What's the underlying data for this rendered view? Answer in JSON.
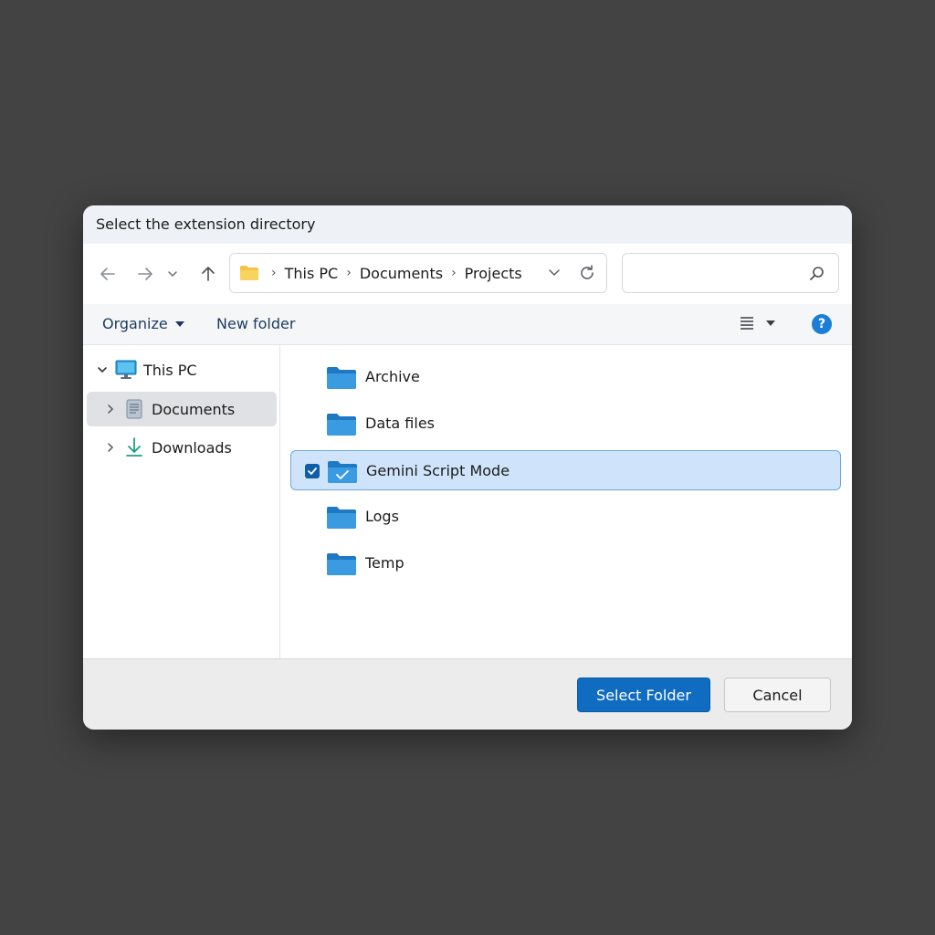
{
  "dialog": {
    "title": "Select the extension directory"
  },
  "navigation": {
    "back_icon": "arrow-left-icon",
    "forward_icon": "arrow-right-icon",
    "recent_icon": "chevron-down-icon",
    "up_icon": "arrow-up-icon"
  },
  "address": {
    "folder_icon": "folder-icon",
    "crumbs": [
      "This PC",
      "Documents",
      "Projects"
    ],
    "refresh_icon": "refresh-icon"
  },
  "search": {
    "value": "",
    "icon": "search-icon"
  },
  "toolbar": {
    "organize_label": "Organize",
    "new_folder_label": "New folder",
    "view_icon": "list-view-icon",
    "help_label": "?"
  },
  "sidebar": {
    "items": [
      {
        "label": "This PC",
        "icon": "monitor-icon",
        "expanded": true
      },
      {
        "label": "Documents",
        "icon": "document-icon",
        "selected": true
      },
      {
        "label": "Downloads",
        "icon": "download-icon"
      }
    ]
  },
  "files": [
    {
      "name": "Archive"
    },
    {
      "name": "Data files"
    },
    {
      "name": "Gemini Script Mode",
      "selected": true
    },
    {
      "name": "Logs"
    },
    {
      "name": "Temp"
    }
  ],
  "footer": {
    "select_label": "Select Folder",
    "cancel_label": "Cancel"
  },
  "colors": {
    "accent": "#0f6cc0",
    "folder": "#2f8fd6",
    "selection": "#cfe4fa"
  }
}
